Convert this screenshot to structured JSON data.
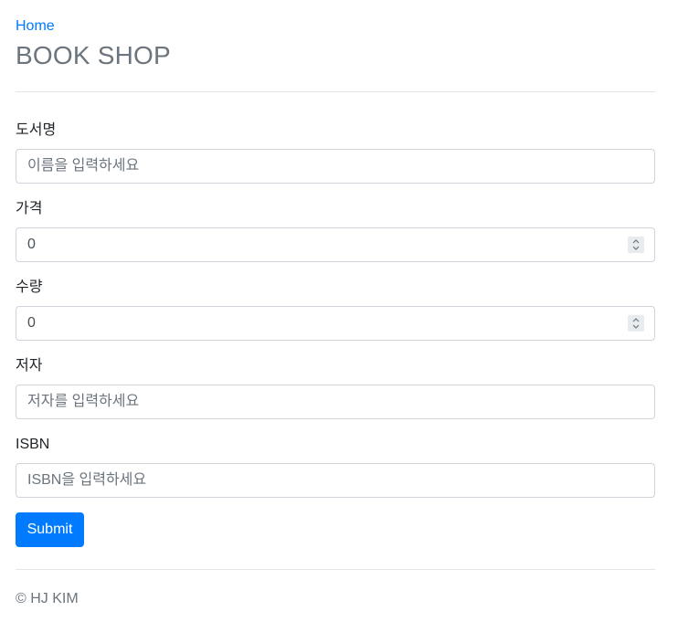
{
  "header": {
    "home_link": "Home",
    "title": "BOOK SHOP"
  },
  "form": {
    "title_field": {
      "label": "도서명",
      "placeholder": "이름을 입력하세요",
      "value": ""
    },
    "price_field": {
      "label": "가격",
      "value": "0"
    },
    "quantity_field": {
      "label": "수량",
      "value": "0"
    },
    "author_field": {
      "label": "저자",
      "placeholder": "저자를 입력하세요",
      "value": ""
    },
    "isbn_field": {
      "label": "ISBN",
      "placeholder": "ISBN을 입력하세요",
      "value": ""
    },
    "submit_label": "Submit"
  },
  "footer": {
    "text": "© HJ KIM"
  },
  "colors": {
    "accent": "#007bff",
    "muted": "#6c757d",
    "border": "#ced4da"
  }
}
